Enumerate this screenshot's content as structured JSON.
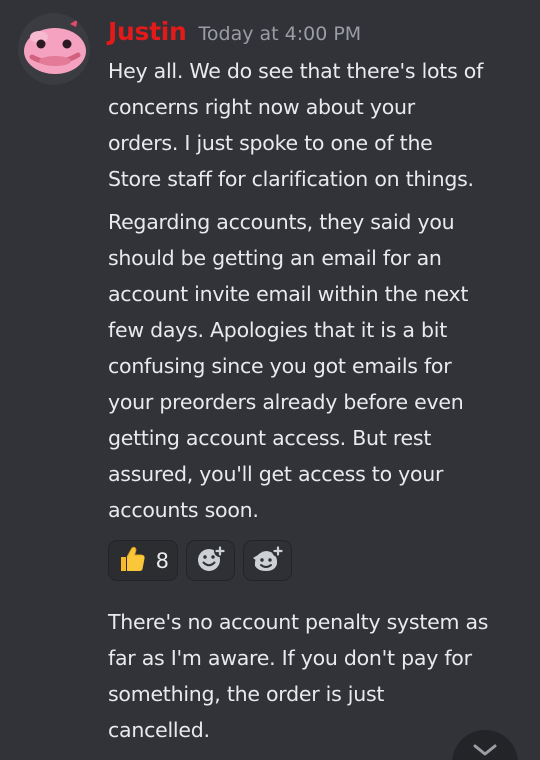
{
  "message": {
    "author": "Justin",
    "timestamp": "Today at 4:00 PM",
    "paragraphs": [
      {
        "lines": [
          "Hey all. We do see that there's lots of",
          "concerns right now about your",
          "orders. I just spoke to one of the",
          "Store staff for clarification on things."
        ]
      },
      {
        "lines": [
          "Regarding accounts, they said you",
          "should be getting an email for an",
          "account invite email within the next",
          "few days. Apologies that it is a bit",
          "confusing since you got emails for",
          "your preorders already before even",
          "getting account access. But rest",
          "assured, you'll get access to your",
          "accounts soon."
        ]
      },
      {
        "lines": [
          "There's no account penalty system as",
          "far as I'm aware. If you don't pay for",
          "something, the order is just",
          "cancelled."
        ]
      }
    ],
    "reactions": [
      {
        "emoji": "thumbs-up",
        "count": "8"
      },
      {
        "emoji": "add-reaction-icon"
      },
      {
        "emoji": "add-super-reaction-icon"
      }
    ]
  },
  "colors": {
    "background": "#313338",
    "username": "#e21a1a",
    "text": "#e9eaec",
    "timestamp": "#9a9da3"
  }
}
